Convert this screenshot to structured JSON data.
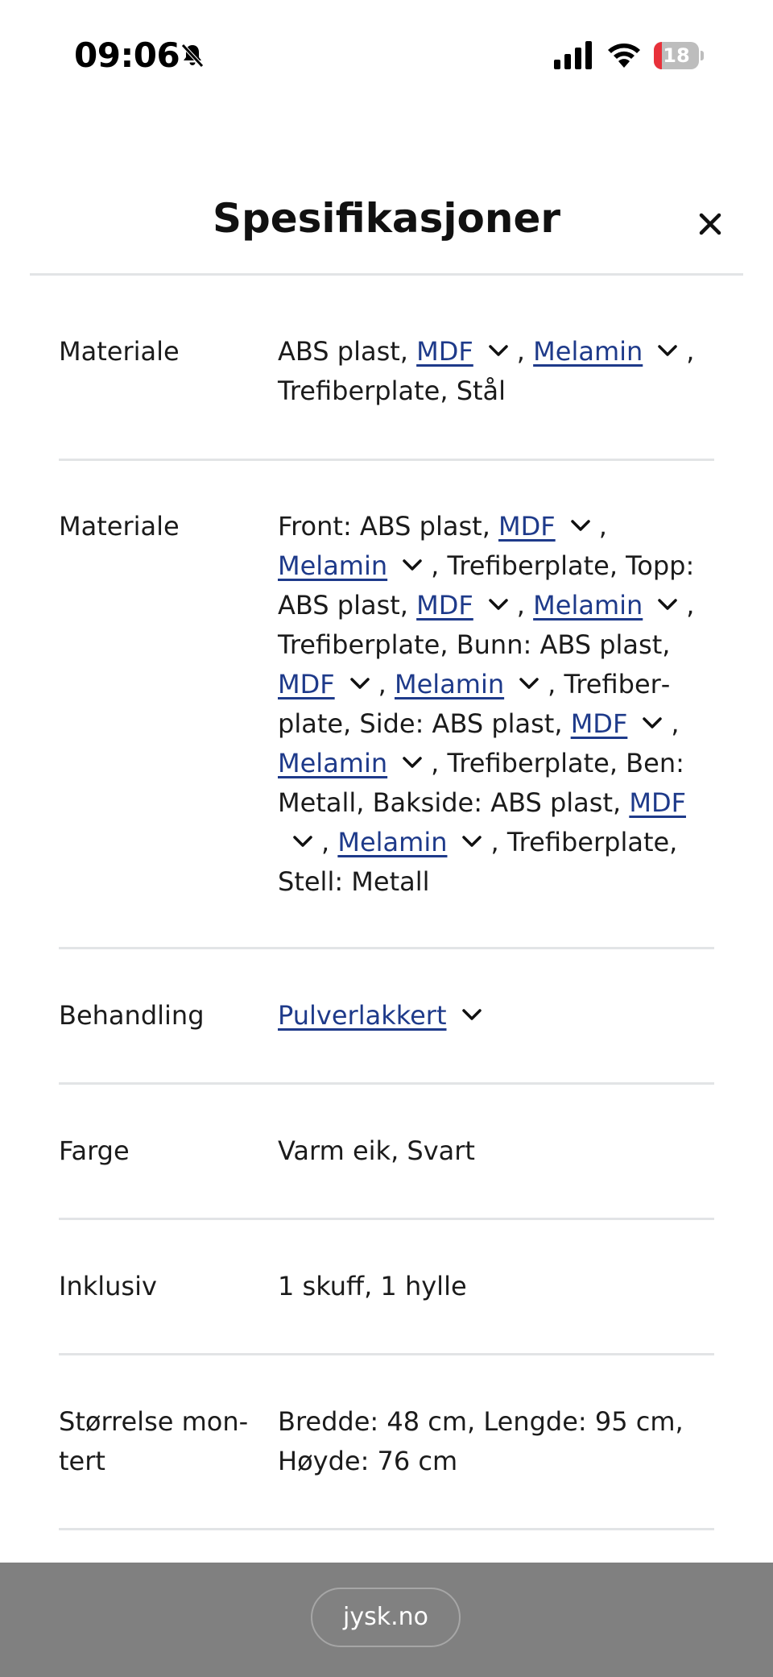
{
  "status_bar": {
    "time": "09:06",
    "battery_level": "18",
    "battery_fraction": 0.18,
    "icons": [
      "bell-slash-icon",
      "cellular-signal-icon",
      "wifi-icon",
      "battery-icon"
    ]
  },
  "header": {
    "title": "Spesifikasjoner",
    "close_icon": "close-icon"
  },
  "colors": {
    "link": "#1e3a8a",
    "divider": "#e2e4e6",
    "bottom_bar": "#808080"
  },
  "specs": [
    {
      "label": "Materiale",
      "parts": [
        {
          "t": "ABS plast, "
        },
        {
          "link": "MDF"
        },
        {
          "t": ", "
        },
        {
          "link": "Melamin"
        },
        {
          "t": ", Trefiberplate, Stål"
        }
      ]
    },
    {
      "label": "Materiale",
      "parts": [
        {
          "t": "Front: ABS plast, "
        },
        {
          "link": "MDF"
        },
        {
          "t": ", "
        },
        {
          "link": "Melamin"
        },
        {
          "t": ", Trefiberplate, Topp: ABS plast, "
        },
        {
          "link": "MDF"
        },
        {
          "t": ", "
        },
        {
          "link": "Melamin"
        },
        {
          "t": ", Trefiberplate, Bunn: ABS plast, "
        },
        {
          "link": "MDF"
        },
        {
          "t": ", "
        },
        {
          "link": "Melamin"
        },
        {
          "t": ", Trefiber­plate, Side: ABS plast, "
        },
        {
          "link": "MDF"
        },
        {
          "t": ", "
        },
        {
          "link": "Melamin"
        },
        {
          "t": ", Trefiberplate, Ben: Metall, Bakside: ABS plast, "
        },
        {
          "link": "MDF"
        },
        {
          "t": ", "
        },
        {
          "link": "Melamin"
        },
        {
          "t": ", Trefiber­plate, Stell: Metall"
        }
      ]
    },
    {
      "label": "Behandling",
      "parts": [
        {
          "link": "Pulverlakkert"
        }
      ]
    },
    {
      "label": "Farge",
      "parts": [
        {
          "t": "Varm eik, Svart"
        }
      ]
    },
    {
      "label": "Inklusiv",
      "parts": [
        {
          "t": "1 skuff, 1 hylle"
        }
      ]
    },
    {
      "label": "Størrelse mon­tert",
      "parts": [
        {
          "t": "Bredde: 48 cm, Lengde: 95 cm, Høyde: 76 cm"
        }
      ]
    }
  ],
  "bottom_bar": {
    "url": "jysk.no"
  }
}
